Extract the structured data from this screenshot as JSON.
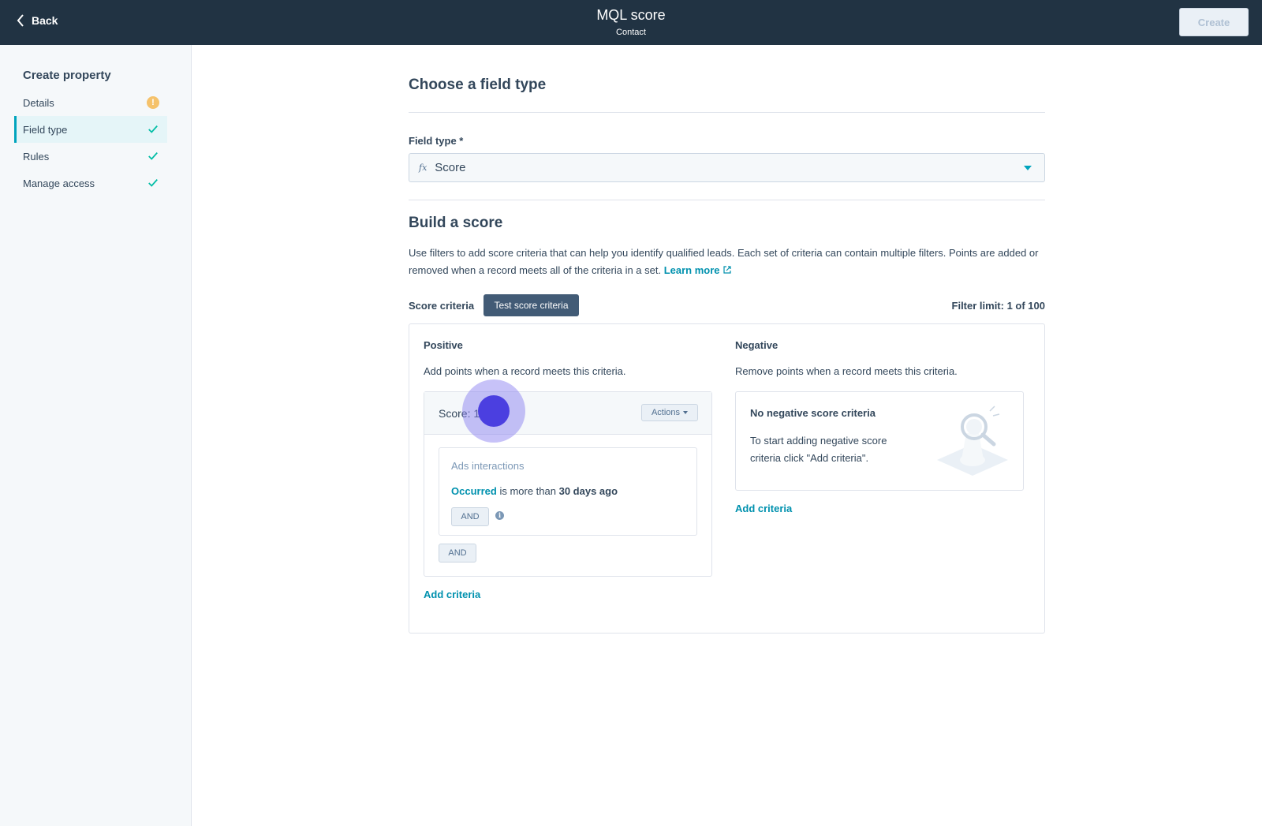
{
  "header": {
    "back_label": "Back",
    "title": "MQL score",
    "subtitle": "Contact",
    "create_label": "Create"
  },
  "sidebar": {
    "title": "Create property",
    "items": [
      {
        "label": "Details",
        "status": "warning"
      },
      {
        "label": "Field type",
        "status": "complete",
        "active": true
      },
      {
        "label": "Rules",
        "status": "complete"
      },
      {
        "label": "Manage access",
        "status": "complete"
      }
    ]
  },
  "main": {
    "section1_title": "Choose a field type",
    "field_type_label": "Field type *",
    "field_type_icon": "fx",
    "field_type_value": "Score",
    "section2_title": "Build a score",
    "description": "Use filters to add score criteria that can help you identify qualified leads. Each set of criteria can contain multiple filters. Points are added or removed when a record meets all of the criteria in a set.",
    "learn_more": "Learn more",
    "score_criteria_label": "Score criteria",
    "test_button": "Test score criteria",
    "filter_limit": "Filter limit: 1 of 100"
  },
  "positive": {
    "title": "Positive",
    "description": "Add points when a record meets this criteria.",
    "score_label": "Score: 1",
    "actions_label": "Actions",
    "filter_name": "Ads interactions",
    "condition_field": "Occurred",
    "condition_operator": "is more than",
    "condition_value": "30 days ago",
    "and_inner": "AND",
    "and_outer": "AND",
    "add_criteria": "Add criteria"
  },
  "negative": {
    "title": "Negative",
    "description": "Remove points when a record meets this criteria.",
    "empty_title": "No negative score criteria",
    "empty_text": "To start adding negative score criteria click \"Add criteria\".",
    "add_criteria": "Add criteria"
  },
  "colors": {
    "header_bg": "#213343",
    "accent": "#00a4bd",
    "link": "#0091ae",
    "warning": "#f5c26b",
    "button_dark": "#425b76",
    "cursor": "#4b3fe0"
  }
}
